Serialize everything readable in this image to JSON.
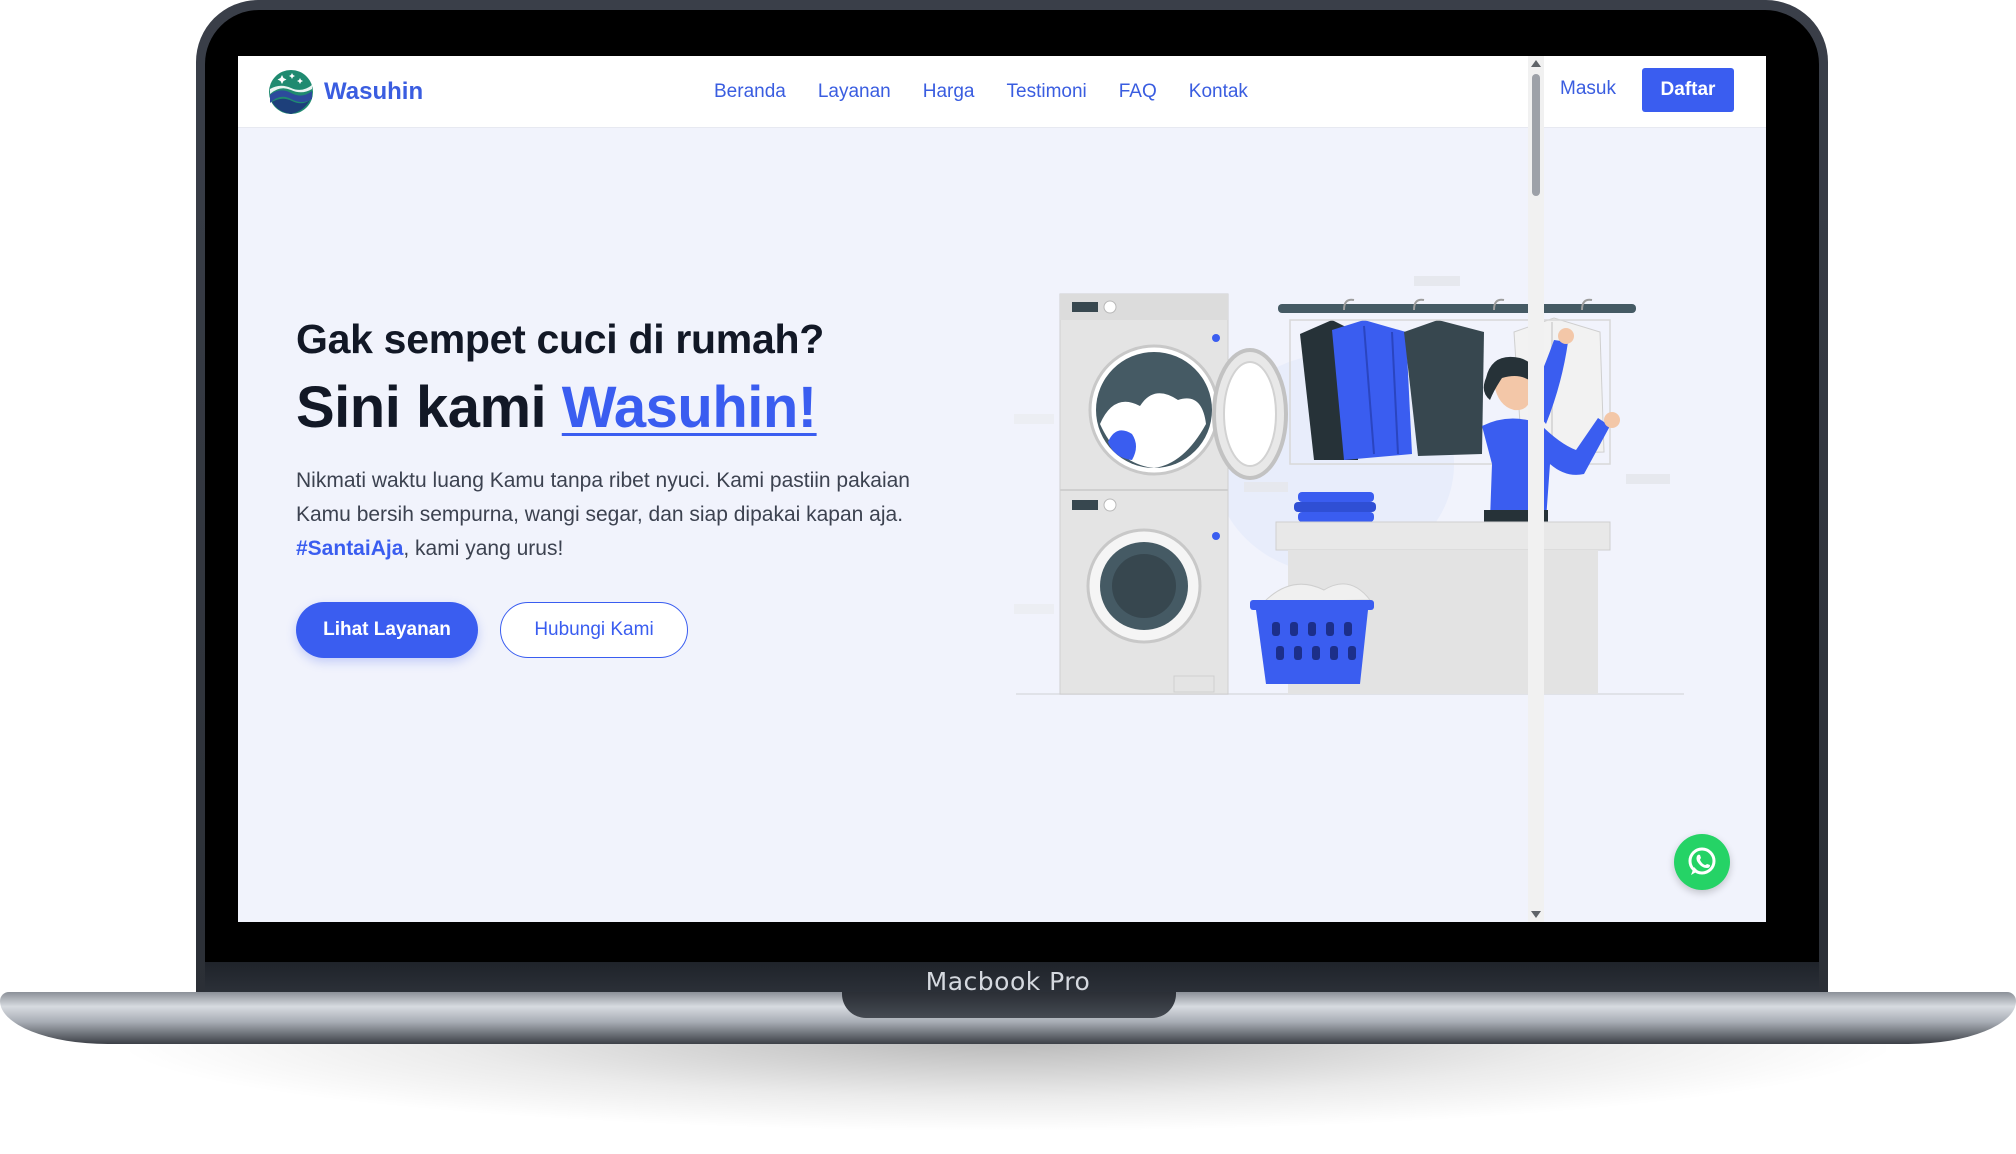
{
  "device": {
    "label": "Macbook Pro"
  },
  "navbar": {
    "brand": "Wasuhin",
    "links": [
      "Beranda",
      "Layanan",
      "Harga",
      "Testimoni",
      "FAQ",
      "Kontak"
    ],
    "login": "Masuk",
    "register": "Daftar"
  },
  "hero": {
    "title_small": "Gak sempet cuci di rumah?",
    "title_prefix": "Sini kami ",
    "title_accent": "Wasuhin!",
    "desc_line1": "Nikmati waktu luang Kamu tanpa ribet nyuci. Kami pastiin pakaian",
    "desc_line2": "Kamu bersih sempurna, wangi segar, dan siap dipakai kapan aja.",
    "hashtag": "#SantaiAja",
    "desc_end": ", kami yang urus!",
    "primary_button": "Lihat Layanan",
    "secondary_button": "Hubungi Kami"
  },
  "icons": {
    "brand_logo": "brand-logo-icon",
    "whatsapp": "whatsapp-icon",
    "illustration": "laundry-illustration"
  },
  "colors": {
    "primary": "#3a5df0",
    "text_dark": "#121826",
    "hero_background": "#f1f3fc",
    "whatsapp": "#25d366"
  }
}
